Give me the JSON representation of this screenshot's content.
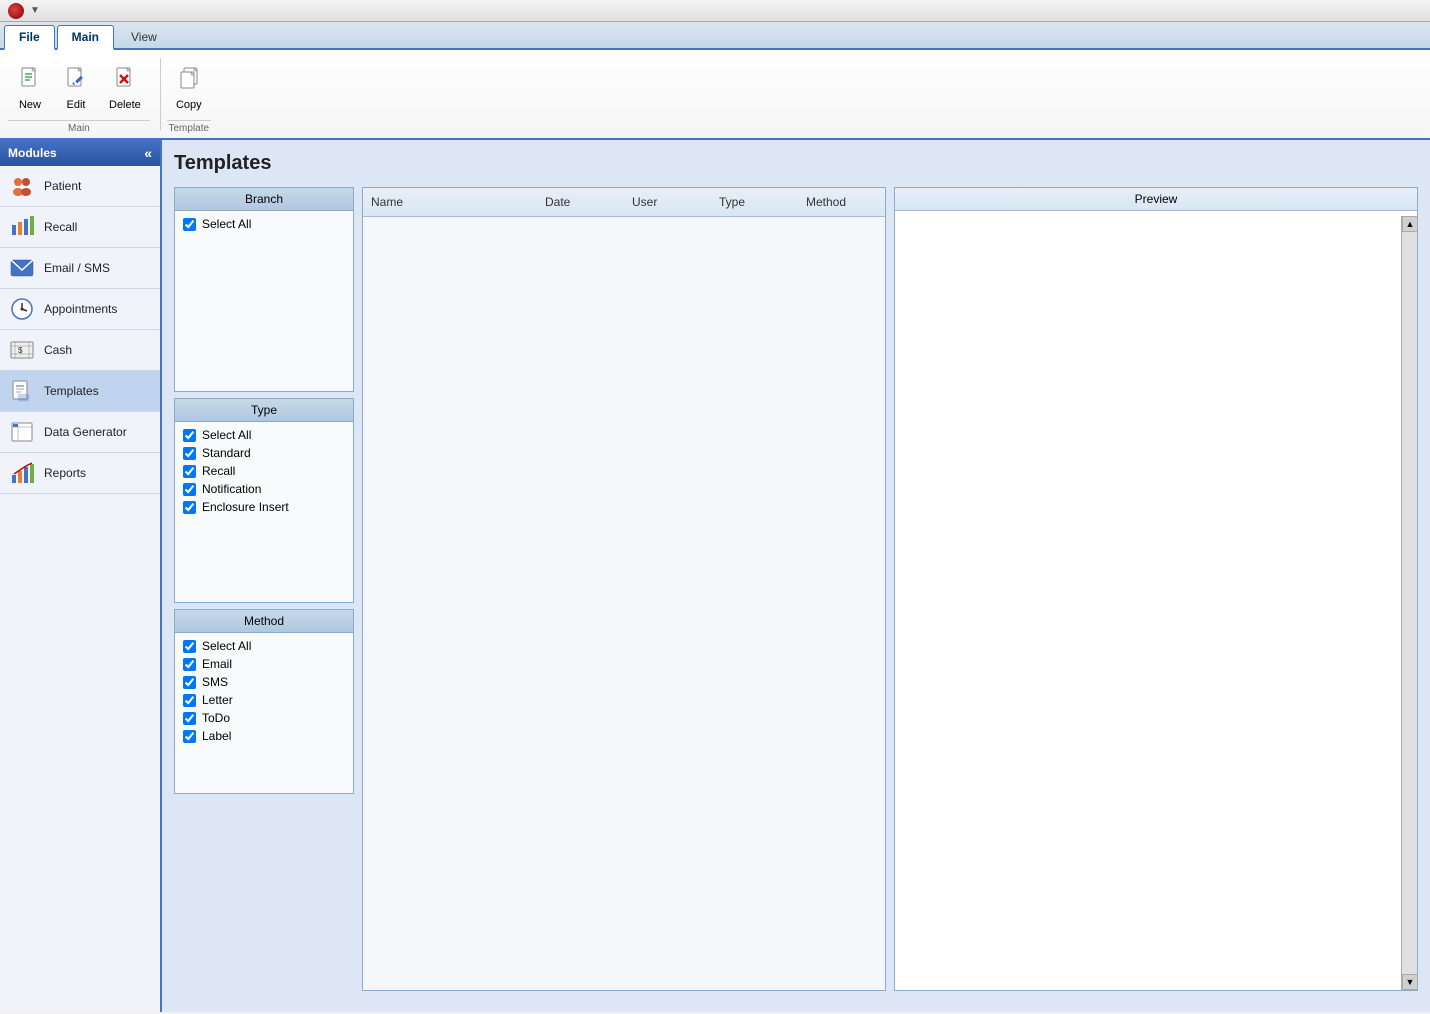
{
  "titlebar": {
    "app_icon": "●",
    "arrow": "▼"
  },
  "ribbon": {
    "tabs": [
      {
        "id": "file",
        "label": "File",
        "active": false
      },
      {
        "id": "main",
        "label": "Main",
        "active": true
      },
      {
        "id": "view",
        "label": "View",
        "active": false
      }
    ],
    "groups": {
      "main": {
        "label": "Main",
        "buttons": [
          {
            "id": "new",
            "label": "New",
            "icon": "📄"
          },
          {
            "id": "edit",
            "label": "Edit",
            "icon": "✏️"
          },
          {
            "id": "delete",
            "label": "Delete",
            "icon": "✖"
          }
        ]
      },
      "template": {
        "label": "Template",
        "buttons": [
          {
            "id": "copy",
            "label": "Copy",
            "icon": "📋"
          }
        ]
      }
    }
  },
  "sidebar": {
    "title": "Modules",
    "collapse_icon": "«",
    "items": [
      {
        "id": "patient",
        "label": "Patient",
        "icon": "👥"
      },
      {
        "id": "recall",
        "label": "Recall",
        "icon": "📊"
      },
      {
        "id": "email-sms",
        "label": "Email / SMS",
        "icon": "✉"
      },
      {
        "id": "appointments",
        "label": "Appointments",
        "icon": "🗓"
      },
      {
        "id": "cash",
        "label": "Cash",
        "icon": "🧮"
      },
      {
        "id": "templates",
        "label": "Templates",
        "icon": "📝",
        "active": true
      },
      {
        "id": "data-generator",
        "label": "Data Generator",
        "icon": "📋"
      },
      {
        "id": "reports",
        "label": "Reports",
        "icon": "📈"
      }
    ]
  },
  "main": {
    "page_title": "Templates",
    "filter": {
      "branch": {
        "header": "Branch",
        "items": [
          {
            "id": "branch-select-all",
            "label": "Select All",
            "checked": true
          }
        ]
      },
      "type": {
        "header": "Type",
        "items": [
          {
            "id": "type-select-all",
            "label": "Select All",
            "checked": true
          },
          {
            "id": "type-standard",
            "label": "Standard",
            "checked": true
          },
          {
            "id": "type-recall",
            "label": "Recall",
            "checked": true
          },
          {
            "id": "type-notification",
            "label": "Notification",
            "checked": true
          },
          {
            "id": "type-enclosure",
            "label": "Enclosure Insert",
            "checked": true
          }
        ]
      },
      "method": {
        "header": "Method",
        "items": [
          {
            "id": "method-select-all",
            "label": "Select All",
            "checked": true
          },
          {
            "id": "method-email",
            "label": "Email",
            "checked": true
          },
          {
            "id": "method-sms",
            "label": "SMS",
            "checked": true
          },
          {
            "id": "method-letter",
            "label": "Letter",
            "checked": true
          },
          {
            "id": "method-todo",
            "label": "ToDo",
            "checked": true
          },
          {
            "id": "method-label",
            "label": "Label",
            "checked": true
          }
        ]
      }
    },
    "table": {
      "columns": [
        "Name",
        "Date",
        "User",
        "Type",
        "Method"
      ],
      "rows": []
    },
    "preview": {
      "header": "Preview"
    }
  }
}
